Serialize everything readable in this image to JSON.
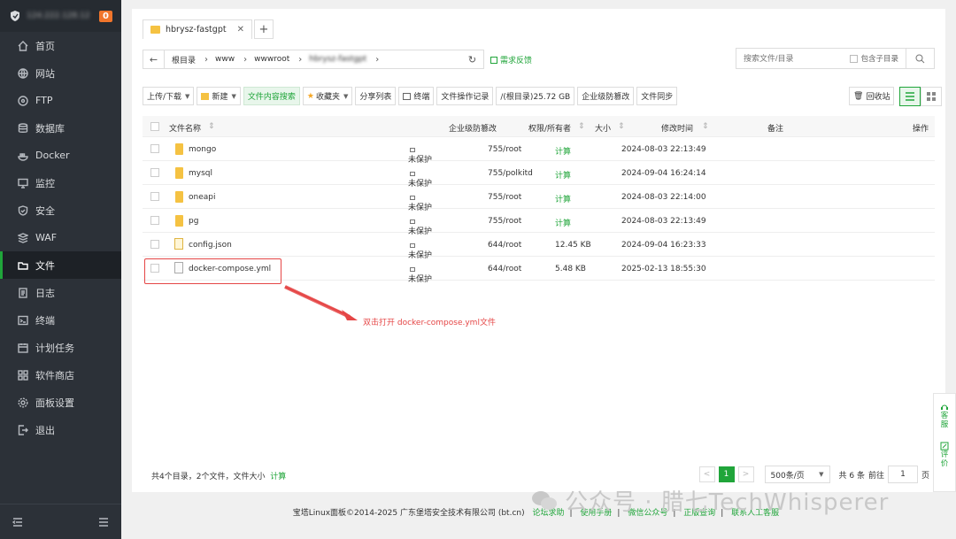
{
  "sidebar": {
    "host": "124.222.128.12",
    "badge": "0",
    "items": [
      {
        "label": "首页",
        "icon": "home-icon"
      },
      {
        "label": "网站",
        "icon": "globe-icon"
      },
      {
        "label": "FTP",
        "icon": "ftp-icon"
      },
      {
        "label": "数据库",
        "icon": "database-icon"
      },
      {
        "label": "Docker",
        "icon": "docker-icon"
      },
      {
        "label": "监控",
        "icon": "monitor-icon"
      },
      {
        "label": "安全",
        "icon": "shield-icon"
      },
      {
        "label": "WAF",
        "icon": "waf-icon"
      },
      {
        "label": "文件",
        "icon": "folder-icon"
      },
      {
        "label": "日志",
        "icon": "log-icon"
      },
      {
        "label": "终端",
        "icon": "terminal-icon"
      },
      {
        "label": "计划任务",
        "icon": "schedule-icon"
      },
      {
        "label": "软件商店",
        "icon": "store-icon"
      },
      {
        "label": "面板设置",
        "icon": "settings-icon"
      },
      {
        "label": "退出",
        "icon": "logout-icon"
      }
    ]
  },
  "tab": {
    "label": "hbrysz-fastgpt",
    "close": "✕",
    "add": "+"
  },
  "path": {
    "back": "←",
    "crumbs": [
      "根目录",
      "www",
      "wwwroot",
      "hbrysz-fastgpt"
    ],
    "refresh": "↻",
    "need_feedback": "需求反馈"
  },
  "search": {
    "placeholder": "搜索文件/目录",
    "subdir_label": "包含子目录"
  },
  "toolbar": {
    "upload": "上传/下载",
    "new": "新建",
    "content_search": "文件内容搜索",
    "favorites": "收藏夹",
    "share_list": "分享列表",
    "terminal": "终端",
    "op_log": "文件操作记录",
    "disk": "/(根目录)25.72 GB",
    "tamper": "企业级防篡改",
    "sync": "文件同步",
    "recycle": "回收站"
  },
  "table": {
    "headers": {
      "name": "文件名称",
      "tamper": "企业级防篡改",
      "perm": "权限/所有者",
      "size": "大小",
      "mtime": "修改时间",
      "note": "备注",
      "ops": "操作"
    },
    "rows": [
      {
        "name": "mongo",
        "type": "folder",
        "tamper": "未保护",
        "perm": "755/root",
        "size": "计算",
        "mtime": "2024-08-03 22:13:49"
      },
      {
        "name": "mysql",
        "type": "folder",
        "tamper": "未保护",
        "perm": "755/polkitd",
        "size": "计算",
        "mtime": "2024-09-04 16:24:14"
      },
      {
        "name": "oneapi",
        "type": "folder",
        "tamper": "未保护",
        "perm": "755/root",
        "size": "计算",
        "mtime": "2024-08-03 22:14:00"
      },
      {
        "name": "pg",
        "type": "folder",
        "tamper": "未保护",
        "perm": "755/root",
        "size": "计算",
        "mtime": "2024-08-03 22:13:49"
      },
      {
        "name": "config.json",
        "type": "json",
        "tamper": "未保护",
        "perm": "644/root",
        "size": "12.45 KB",
        "mtime": "2024-09-04 16:23:33"
      },
      {
        "name": "docker-compose.yml",
        "type": "file",
        "tamper": "未保护",
        "perm": "644/root",
        "size": "5.48 KB",
        "mtime": "2025-02-13 18:55:30"
      }
    ]
  },
  "annotation": "双击打开 docker-compose.yml文件",
  "summary": {
    "text": "共4个目录，2个文件，文件大小",
    "calc": "计算"
  },
  "pager": {
    "prev": "<",
    "current": "1",
    "next": ">",
    "per_page": "500条/页",
    "total": "共 6 条",
    "goto": "前往",
    "page_input": "1",
    "page_unit": "页"
  },
  "copyright": {
    "text": "宝塔Linux面板©2014-2025 广东堡塔安全技术有限公司 (bt.cn)",
    "links": [
      "论坛求助",
      "使用手册",
      "微信公众号",
      "正版查询",
      "联系人工客服"
    ]
  },
  "float": {
    "service": "客服",
    "review": "评价"
  },
  "watermark": "公众号 · 腊七TechWhisperer",
  "colors": {
    "accent": "#20a53a",
    "sidebar": "#2c3138",
    "highlight": "#e54646",
    "folder": "#f5c242"
  }
}
